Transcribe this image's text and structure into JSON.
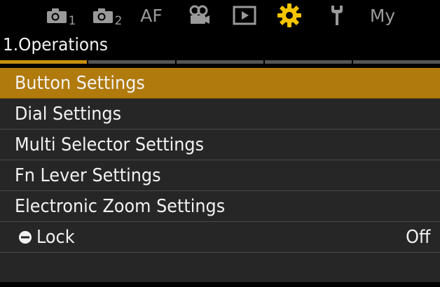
{
  "tabs": [
    {
      "icon": "camera-icon",
      "sub": "1"
    },
    {
      "icon": "camera-icon",
      "sub": "2"
    },
    {
      "label": "AF"
    },
    {
      "icon": "movie-camera-icon"
    },
    {
      "icon": "playback-icon"
    },
    {
      "icon": "gear-icon",
      "active": true
    },
    {
      "icon": "wrench-icon"
    },
    {
      "label": "My"
    }
  ],
  "section_title": "1.Operations",
  "menu": {
    "items": [
      {
        "label": "Button Settings",
        "selected": true
      },
      {
        "label": "Dial Settings"
      },
      {
        "label": "Multi Selector Settings"
      },
      {
        "label": "Fn Lever Settings"
      },
      {
        "label": "Electronic Zoom Settings"
      },
      {
        "label": "Lock",
        "icon": "control-lock-icon",
        "value": "Off"
      }
    ]
  },
  "colors": {
    "accent": "#b17a0c",
    "active_tab": "#f4c400",
    "row_bg": "#262626",
    "inactive_tab": "#9a9a9a"
  }
}
